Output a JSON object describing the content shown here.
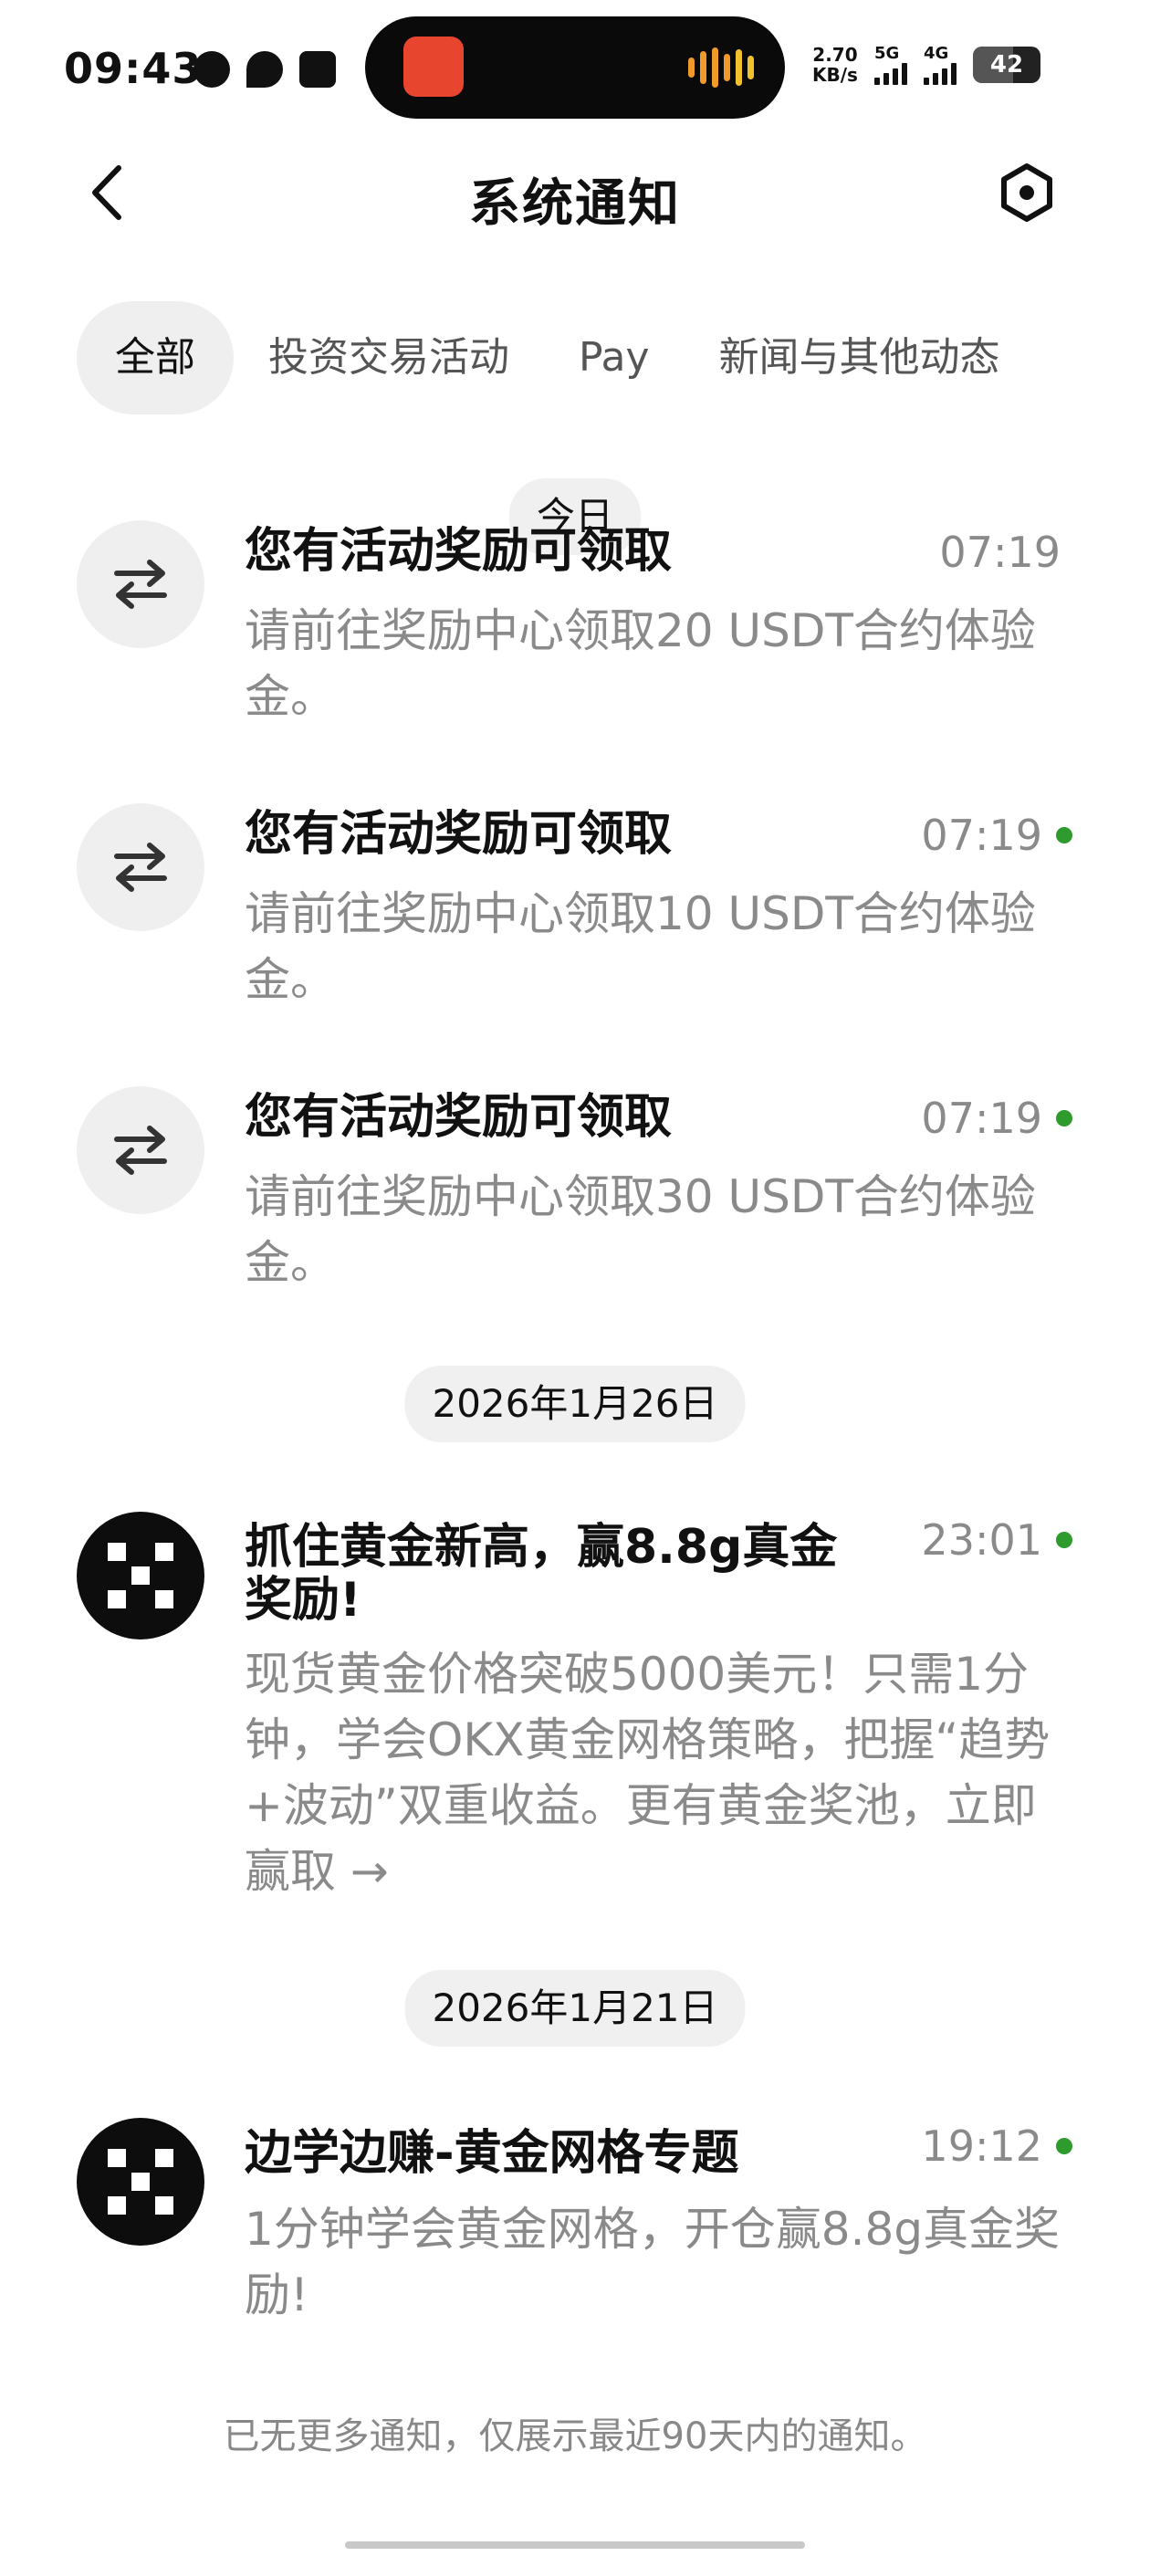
{
  "status_bar": {
    "time": "09:43",
    "net_speed_value": "2.70",
    "net_speed_unit": "KB/s",
    "network_1": "5G",
    "network_2": "4G",
    "battery": "42"
  },
  "header": {
    "title": "系统通知"
  },
  "tabs": [
    {
      "label": "全部",
      "active": true
    },
    {
      "label": "投资交易活动",
      "active": false
    },
    {
      "label": "Pay",
      "active": false
    },
    {
      "label": "新闻与其他动态",
      "active": false
    }
  ],
  "groups": [
    {
      "date": "今日"
    },
    {
      "date": "2026年1月26日"
    },
    {
      "date": "2026年1月21日"
    }
  ],
  "notifications": [
    {
      "icon": "transfer-icon",
      "title": "您有活动奖励可领取",
      "body": "请前往奖励中心领取20 USDT合约体验金。",
      "time": "07:19",
      "unread": false
    },
    {
      "icon": "transfer-icon",
      "title": "您有活动奖励可领取",
      "body": "请前往奖励中心领取10 USDT合约体验金。",
      "time": "07:19",
      "unread": true
    },
    {
      "icon": "transfer-icon",
      "title": "您有活动奖励可领取",
      "body": "请前往奖励中心领取30 USDT合约体验金。",
      "time": "07:19",
      "unread": true
    },
    {
      "icon": "okx-logo-icon",
      "title": "抓住黄金新高，赢8.8g真金奖励!",
      "body": "现货黄金价格突破5000美元！只需1分钟，学会OKX黄金网格策略，把握“趋势+波动”双重收益。更有黄金奖池，立即赢取 →",
      "time": "23:01",
      "unread": true
    },
    {
      "icon": "okx-logo-icon",
      "title": "边学边赚-黄金网格专题",
      "body": "1分钟学会黄金网格，开仓赢8.8g真金奖励!",
      "time": "19:12",
      "unread": true
    }
  ],
  "footer": {
    "text": "已无更多通知，仅展示最近90天内的通知。"
  },
  "colors": {
    "unread_dot": "#2f9b2f",
    "muted_text": "#8a8a8a",
    "pill_bg": "#f0f0f0"
  }
}
